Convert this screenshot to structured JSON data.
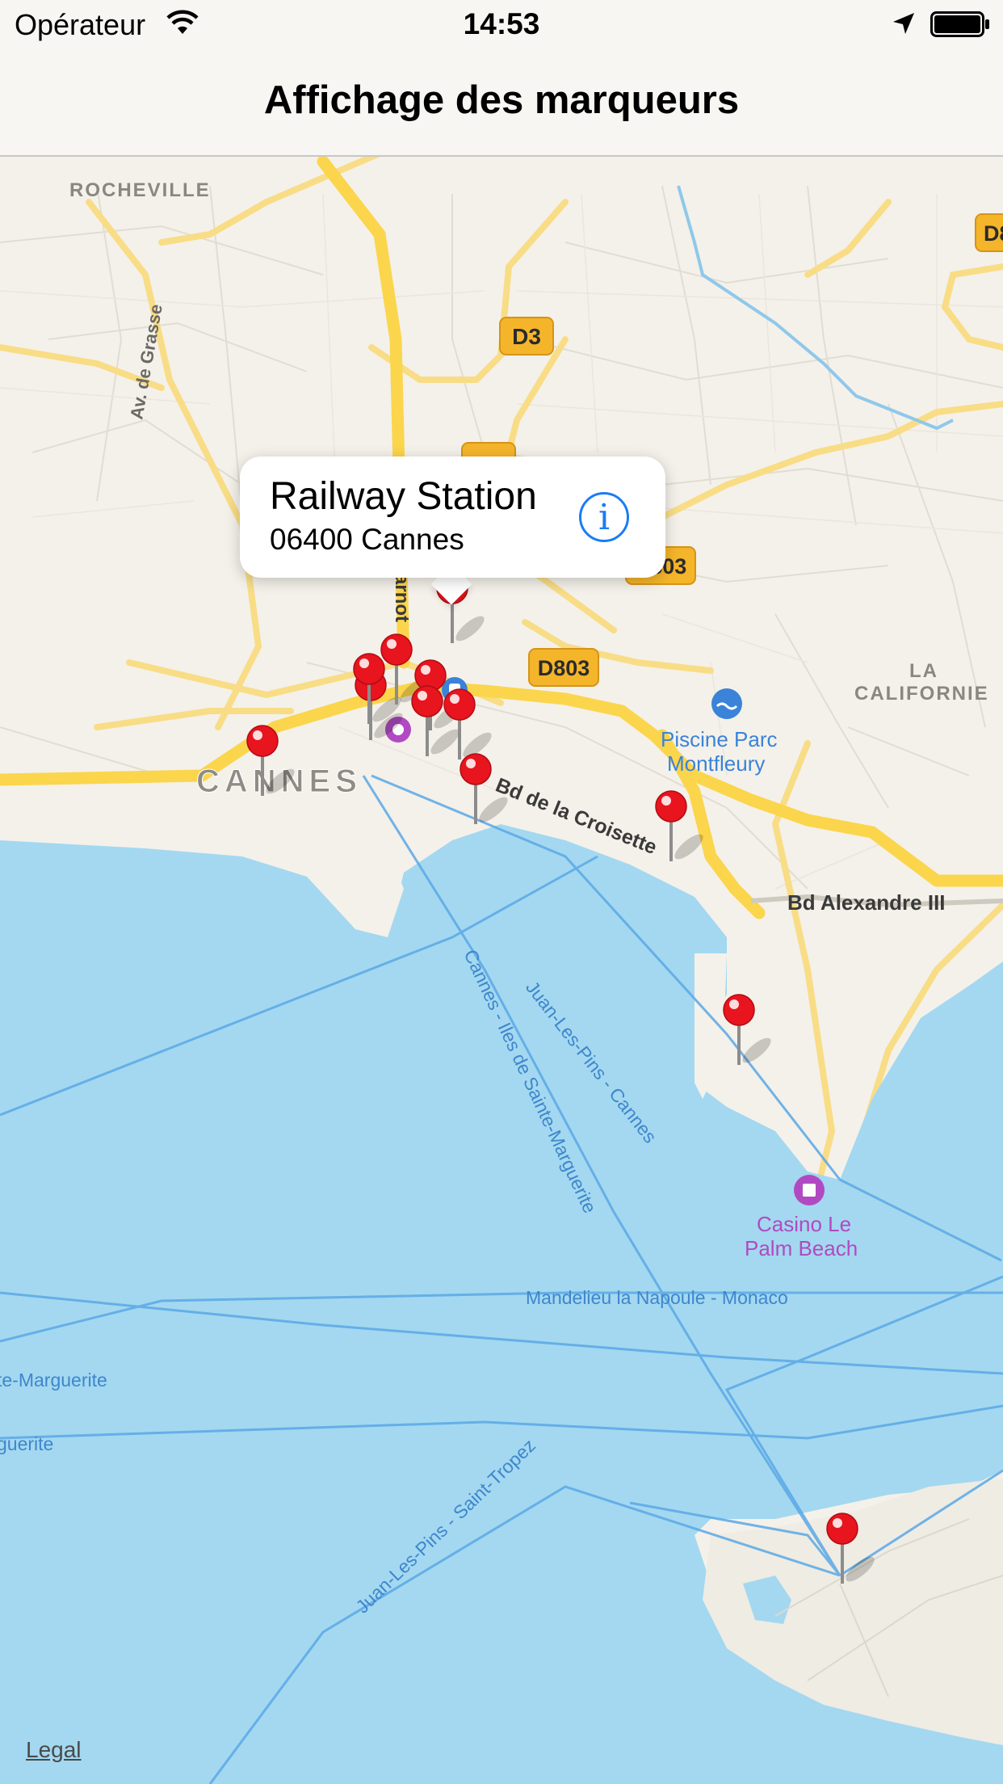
{
  "status_bar": {
    "carrier": "Opérateur",
    "time": "14:53",
    "icons": [
      "wifi-icon",
      "location-arrow-icon",
      "battery-icon"
    ]
  },
  "nav": {
    "title": "Affichage des marqueurs"
  },
  "map": {
    "colors": {
      "land": "#f4f1ea",
      "water": "#a3d8f0",
      "major_road": "#fbd54c",
      "minor_road": "#f7e6b0",
      "pin": "#e8141e",
      "route": "#5ba8e6"
    },
    "place_labels": {
      "rocheville": "ROCHEVILLE",
      "cannes": "CANNES",
      "la": "LA",
      "californie": "CALIFORNIE",
      "piscine_1": "Piscine Parc",
      "piscine_2": "Montfleury",
      "casino_1": "Casino Le",
      "casino_2": "Palm Beach"
    },
    "road_labels": {
      "av_grasse": "Av. de Grasse",
      "carnot": "arnot",
      "croisette": "Bd de la Croisette",
      "alexandre": "Bd Alexandre III"
    },
    "road_shields": {
      "d3": "D3",
      "d3b": "D3",
      "d803": "D803",
      "d803b": "D803",
      "d8": "D8"
    },
    "ferry_labels": {
      "juan_cannes": "Juan-Les-Pins - Cannes",
      "cannes_iles": "Cannes - Iles de Sainte-Marguerite",
      "mandelieu": "Mandelieu la Napoule - Monaco",
      "sainte_marguerite_1": "te-Marguerite",
      "sainte_marguerite_2": "guerite",
      "juan_tropez": "Juan-Les-Pins - Saint-Tropez"
    },
    "pin_count": 12,
    "selected_pin": {
      "title": "Railway Station",
      "subtitle": "06400 Cannes"
    }
  },
  "legal": "Legal"
}
